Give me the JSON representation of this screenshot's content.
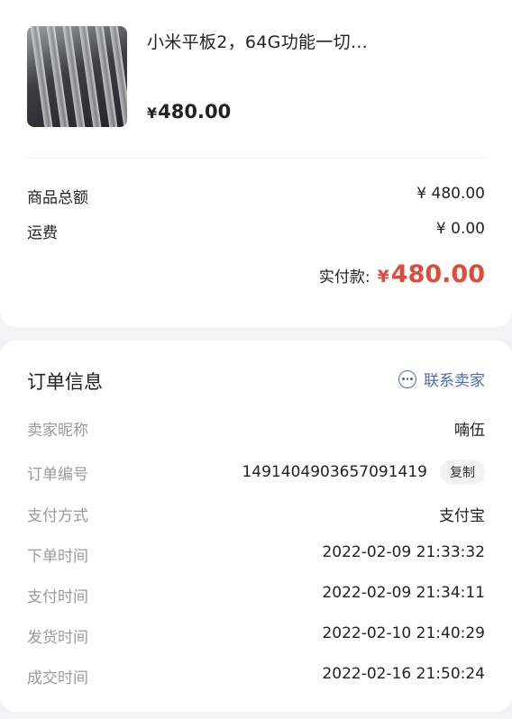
{
  "product": {
    "image_icon": "product-photo",
    "title": "小米平板2，64G功能一切…",
    "price_symbol": "¥",
    "price": "480.00"
  },
  "summary": {
    "total_label": "商品总额",
    "total_value": "¥ 480.00",
    "shipping_label": "运费",
    "shipping_value": "¥ 0.00",
    "paid_label": "实付款:",
    "paid_symbol": "¥",
    "paid_value": "480.00",
    "paid_color": "#e04a3c"
  },
  "order_info": {
    "title": "订单信息",
    "contact_label": "联系卖家",
    "contact_icon": "chat-bubble-icon",
    "accent_color": "#4a6cb3",
    "rows": [
      {
        "label": "卖家昵称",
        "value": "喃伍"
      },
      {
        "label": "订单编号",
        "value": "1491404903657091419",
        "action": "复制"
      },
      {
        "label": "支付方式",
        "value": "支付宝"
      },
      {
        "label": "下单时间",
        "value": "2022-02-09 21:33:32"
      },
      {
        "label": "支付时间",
        "value": "2022-02-09 21:34:11"
      },
      {
        "label": "发货时间",
        "value": "2022-02-10 21:40:29"
      },
      {
        "label": "成交时间",
        "value": "2022-02-16 21:50:24"
      }
    ]
  }
}
